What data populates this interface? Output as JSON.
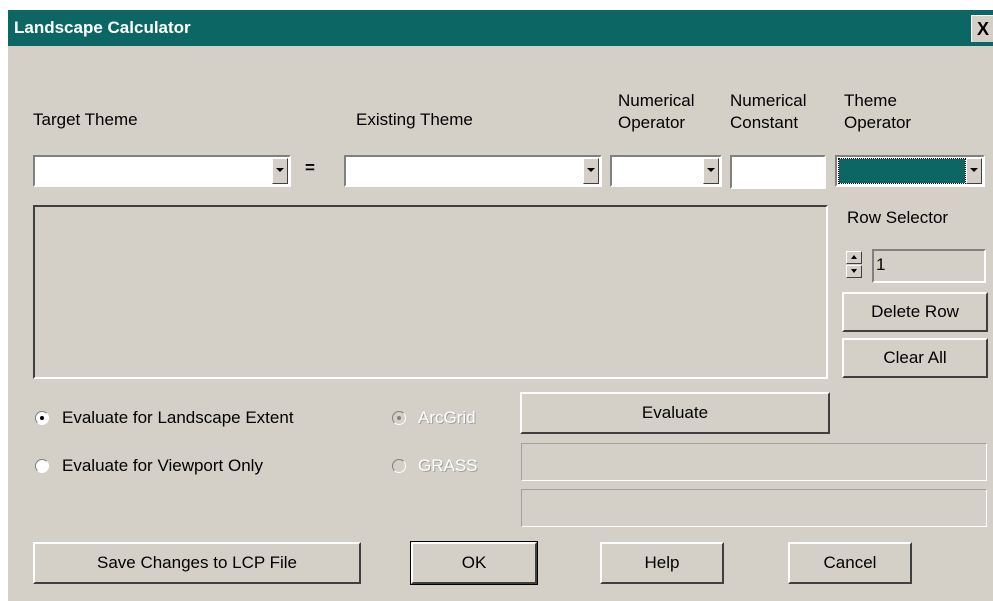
{
  "window": {
    "title": "Landscape Calculator",
    "close_glyph": "X"
  },
  "headers": {
    "target_theme": "Target Theme",
    "existing_theme": "Existing Theme",
    "numerical_operator": [
      "Numerical",
      "Operator"
    ],
    "numerical_constant": [
      "Numerical",
      "Constant"
    ],
    "theme_operator": [
      "Theme",
      "Operator"
    ]
  },
  "equals_sign": "=",
  "fields": {
    "target_theme_value": "",
    "existing_theme_value": "",
    "numerical_operator_value": "",
    "numerical_constant_value": "",
    "theme_operator_value": ""
  },
  "row_selector": {
    "label": "Row Selector",
    "value": "1"
  },
  "buttons": {
    "delete_row": "Delete Row",
    "clear_all": "Clear All",
    "evaluate": "Evaluate",
    "save_changes": "Save Changes to LCP File",
    "ok": "OK",
    "help": "Help",
    "cancel": "Cancel"
  },
  "extent_options": [
    {
      "label": "Evaluate for Landscape Extent",
      "checked": true
    },
    {
      "label": "Evaluate for Viewport Only",
      "checked": false
    }
  ],
  "engine_options": [
    {
      "label": "ArcGrid",
      "checked": true,
      "disabled": true
    },
    {
      "label": "GRASS",
      "checked": false,
      "disabled": true
    }
  ],
  "colors": {
    "titlebar": "#0c6764",
    "face": "#d4d0c8",
    "selection": "#0c6764"
  }
}
